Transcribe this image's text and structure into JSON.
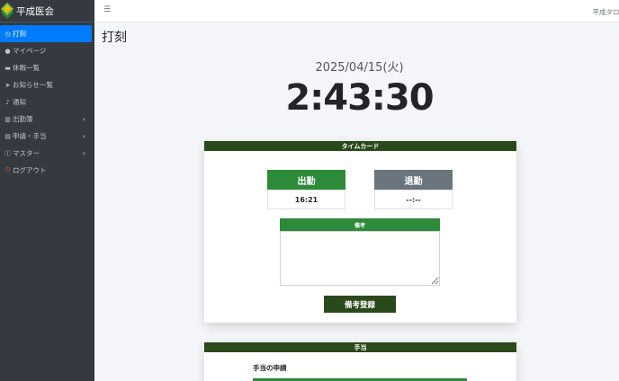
{
  "sidebar": {
    "brand": "平成医会",
    "items": [
      {
        "label": "打刻",
        "icon": "clock-icon"
      },
      {
        "label": "マイページ",
        "icon": "user-icon"
      },
      {
        "label": "休暇一覧",
        "icon": "bed-icon"
      },
      {
        "label": "お知らせ一覧",
        "icon": "paper-plane-icon"
      },
      {
        "label": "通知",
        "icon": "bell-icon"
      },
      {
        "label": "出勤簿",
        "icon": "book-icon"
      },
      {
        "label": "申請・手当",
        "icon": "list-icon"
      },
      {
        "label": "マスター",
        "icon": "info-icon"
      },
      {
        "label": "ログアウト",
        "icon": "power-icon"
      }
    ]
  },
  "topbar": {
    "menu_icon": "☰",
    "user": "平成タロウ"
  },
  "page": {
    "title": "打刻"
  },
  "clock": {
    "date": "2025/04/15(火)",
    "time": "2:43:30"
  },
  "timecard": {
    "header": "タイムカード",
    "clock_in_label": "出勤",
    "clock_out_label": "退勤",
    "clock_in_time": "16:21",
    "clock_out_time": "--:--",
    "memo_header": "備考",
    "memo_value": "",
    "memo_button": "備考登録"
  },
  "allowance": {
    "header": "手当",
    "section_label": "手当の申請"
  },
  "colors": {
    "sidebar_bg": "#343a40",
    "active_item": "#007bff",
    "card_header": "#2a4a1b",
    "clock_in": "#2e8b3a",
    "clock_out": "#6c757d"
  }
}
